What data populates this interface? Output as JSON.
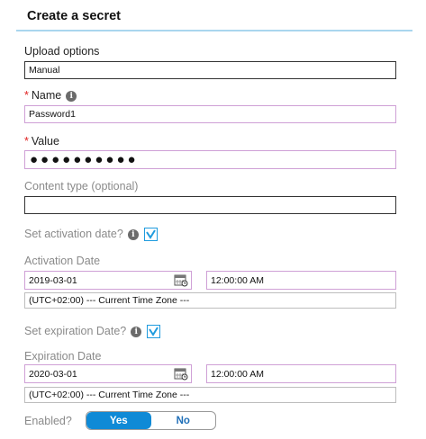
{
  "header": {
    "title": "Create a secret"
  },
  "upload": {
    "label": "Upload options",
    "value": "Manual"
  },
  "name": {
    "required_mark": "*",
    "label": "Name",
    "value": "Password1"
  },
  "secret_value": {
    "required_mark": "*",
    "label": "Value",
    "masked": "●●●●●●●●●●"
  },
  "content_type": {
    "label": "Content type (optional)",
    "value": ""
  },
  "activation": {
    "toggle_label": "Set activation date?",
    "checked": true,
    "date_label": "Activation Date",
    "date": "2019-03-01",
    "time": "12:00:00 AM",
    "timezone": "(UTC+02:00) --- Current Time Zone ---"
  },
  "expiration": {
    "toggle_label": "Set expiration Date?",
    "checked": true,
    "date_label": "Expiration Date",
    "date": "2020-03-01",
    "time": "12:00:00 AM",
    "timezone": "(UTC+02:00) --- Current Time Zone ---"
  },
  "enabled": {
    "label": "Enabled?",
    "yes": "Yes",
    "no": "No",
    "selected": "Yes"
  },
  "colors": {
    "accent": "#0f8ad6",
    "header_rule": "#a9d6ee",
    "required": "#e02020",
    "field_border": "#cfa0d6"
  }
}
